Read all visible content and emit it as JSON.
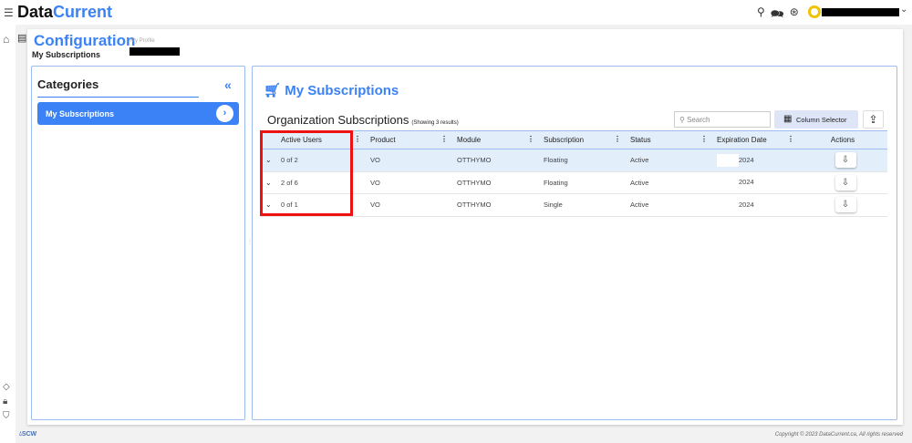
{
  "header": {
    "logo_a": "Data",
    "logo_b": "Current"
  },
  "page": {
    "title": "Configuration",
    "my_profile": "My Profile",
    "subtitle": "My Subscriptions"
  },
  "categories": {
    "title": "Categories",
    "items": [
      {
        "label": "My Subscriptions"
      }
    ]
  },
  "main": {
    "title": "My Subscriptions",
    "table_title": "Organization Subscriptions",
    "count": "(Showing 3 results)",
    "search_placeholder": "Search",
    "column_selector": "Column Selector"
  },
  "table": {
    "headers": [
      "Active Users",
      "Product",
      "Module",
      "Subscription",
      "Status",
      "Expiration Date",
      "Actions"
    ],
    "rows": [
      {
        "active_users": "0 of 2",
        "product": "VO",
        "module": "OTTHYMO",
        "subscription": "Floating",
        "status": "Active",
        "expiration": "2024"
      },
      {
        "active_users": "2 of 6",
        "product": "VO",
        "module": "OTTHYMO",
        "subscription": "Floating",
        "status": "Active",
        "expiration": "2024"
      },
      {
        "active_users": "0 of 1",
        "product": "VO",
        "module": "OTTHYMO",
        "subscription": "Single",
        "status": "Active",
        "expiration": "2024"
      }
    ]
  },
  "footer": {
    "logo": "SCW",
    "copyright": "Copyright © 2023 DataCurrent.ca, All rights reserved"
  }
}
